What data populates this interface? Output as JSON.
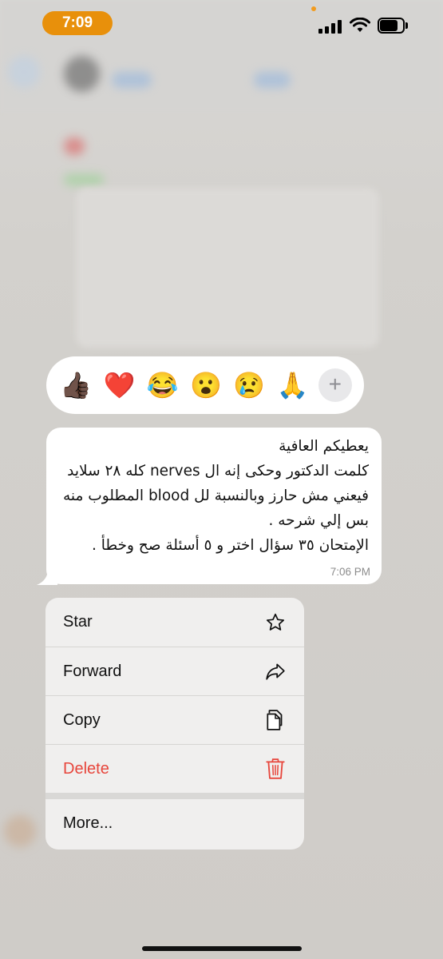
{
  "status_bar": {
    "time": "7:09",
    "icons": [
      "signal-icon",
      "wifi-icon",
      "battery-icon"
    ],
    "pill_color": "#e8900b"
  },
  "reactions": {
    "items": [
      {
        "name": "thumbs-up",
        "glyph": "👍🏿"
      },
      {
        "name": "heart",
        "glyph": "❤️"
      },
      {
        "name": "joy",
        "glyph": "😂"
      },
      {
        "name": "surprised",
        "glyph": "😮"
      },
      {
        "name": "crying",
        "glyph": "😢"
      },
      {
        "name": "pray",
        "glyph": "🙏"
      }
    ],
    "more_glyph": "+"
  },
  "message": {
    "text": "يعطيكم العافية\nكلمت الدكتور وحكى إنه ال nerves كله ٢٨ سلايد فيعني مش حارز وبالنسبة لل blood المطلوب منه بس إلي شرحه .\nالإمتحان ٣٥ سؤال اختر و ٥ أسئلة صح وخطأ .",
    "time": "7:06 PM"
  },
  "menu": {
    "star": "Star",
    "forward": "Forward",
    "copy": "Copy",
    "delete": "Delete",
    "more": "More...",
    "danger_color": "#e7453b"
  }
}
